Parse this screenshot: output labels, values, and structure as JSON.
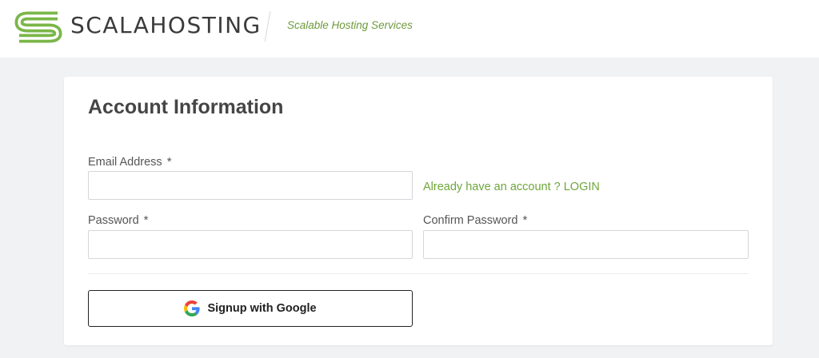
{
  "header": {
    "brand": "SCALAHOSTING",
    "tagline": "Scalable Hosting Services",
    "logo_icon": "scalahosting-s-logo-icon",
    "brand_color": "#7ab648"
  },
  "form": {
    "title": "Account Information",
    "email": {
      "label": "Email Address",
      "required_marker": "*",
      "value": ""
    },
    "login_link": "Already have an account ? LOGIN",
    "password": {
      "label": "Password",
      "required_marker": "*",
      "value": ""
    },
    "confirm_password": {
      "label": "Confirm Password",
      "required_marker": "*",
      "value": ""
    },
    "google_button": {
      "label": "Signup with Google",
      "icon": "google-icon"
    }
  }
}
